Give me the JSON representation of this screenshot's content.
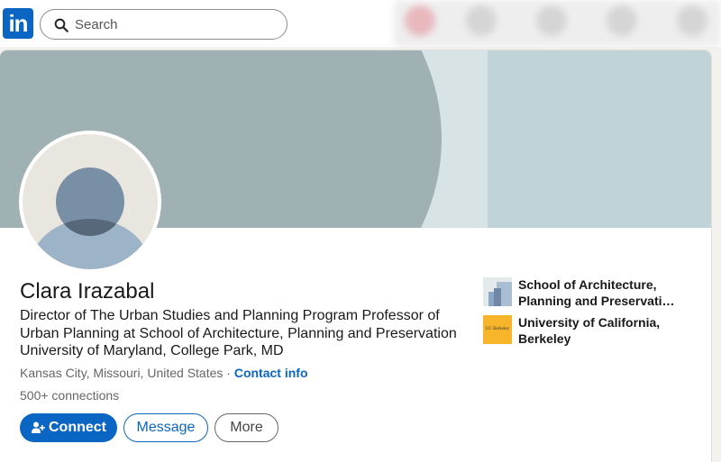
{
  "nav": {
    "logo_text": "in",
    "search": {
      "placeholder": "Search",
      "value": ""
    }
  },
  "profile": {
    "name": "Clara Irazabal",
    "headline": "Director of The Urban Studies and Planning Program Professor of Urban Planning at School of Architecture, Planning and Preservation University of Maryland, College Park, MD",
    "location": "Kansas City, Missouri, United States",
    "separator": " · ",
    "contact_info_label": "Contact info",
    "connections": "500+ connections"
  },
  "actions": {
    "connect_label": "Connect",
    "message_label": "Message",
    "more_label": "More"
  },
  "organizations": [
    {
      "line1": "School of Architecture,",
      "line2": "Planning and Preservation..."
    },
    {
      "line1": "University of California,",
      "line2": "Berkeley",
      "logo_text": "UC Berkeley"
    }
  ],
  "colors": {
    "brand_blue": "#0a66c2",
    "banner_dark": "#a0b1b4",
    "banner_light": "#c0d4d7",
    "ucb_gold": "#f7b52b"
  },
  "icons": [
    "search-icon",
    "add-person-icon"
  ]
}
